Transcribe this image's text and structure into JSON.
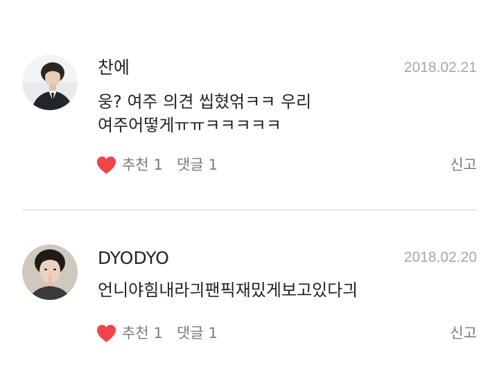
{
  "comments": [
    {
      "author": "찬에",
      "date": "2018.02.21",
      "text": "웅?  여주 의견 씹혔얶ㅋㅋ   우리\n여주어떻게ㅠㅠㅋㅋㅋㅋㅋ",
      "like_label": "추천",
      "like_count": "1",
      "reply_label": "댓글",
      "reply_count": "1",
      "report_label": "신고",
      "avatar_icon": "avatar-man-suit"
    },
    {
      "author": "DYODYO",
      "date": "2018.02.20",
      "text": "언니야힘내라긔팬픽재밌게보고있다긔",
      "like_label": "추천",
      "like_count": "1",
      "reply_label": "댓글",
      "reply_count": "1",
      "report_label": "신고",
      "avatar_icon": "avatar-man-finger-lips"
    }
  ],
  "colors": {
    "heart": "#f0444b",
    "meta_text": "#a6a6a6",
    "action_text": "#7a7a7a",
    "divider": "#e6e6e6"
  }
}
